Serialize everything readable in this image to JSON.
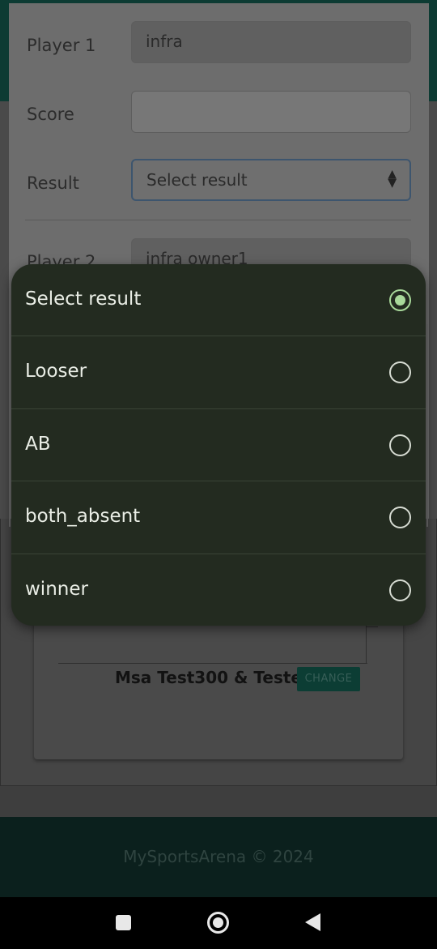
{
  "form": {
    "player1_label": "Player 1",
    "player1_value": "infra",
    "score_label": "Score",
    "score_value": "",
    "result_label": "Result",
    "result_value": "Select result",
    "player2_label": "Player 2",
    "player2_value": "infra owner1"
  },
  "team": {
    "name": "Msa Test300 & Tester",
    "change_label": "CHANGE"
  },
  "footer": {
    "text": "MySportsArena © 2024"
  },
  "dialog": {
    "options": [
      {
        "label": "Select result",
        "selected": true
      },
      {
        "label": "Looser",
        "selected": false
      },
      {
        "label": "AB",
        "selected": false
      },
      {
        "label": "both_absent",
        "selected": false
      },
      {
        "label": "winner",
        "selected": false
      }
    ]
  },
  "colors": {
    "accent": "#a8d89a",
    "dialog_bg": "#232b20",
    "footer_bg": "#0b201d",
    "brand": "#0c3d34"
  },
  "icons": {
    "nav_recents": "square-icon",
    "nav_home": "home-circle-icon",
    "nav_back": "back-triangle-icon",
    "select_arrow": "updown-chevron-icon"
  }
}
